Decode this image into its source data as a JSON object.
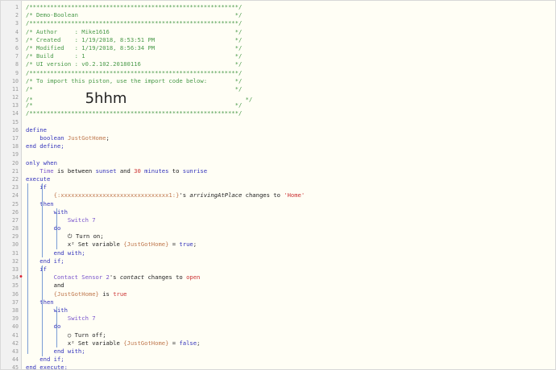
{
  "editor": {
    "lines": [
      {
        "n": "1",
        "parts": [
          {
            "t": "/************************************************************/",
            "c": "c"
          }
        ]
      },
      {
        "n": "2",
        "parts": [
          {
            "t": "/* Demo-Boolean                                             */",
            "c": "c"
          }
        ]
      },
      {
        "n": "3",
        "parts": [
          {
            "t": "/************************************************************/",
            "c": "c"
          }
        ]
      },
      {
        "n": "4",
        "parts": [
          {
            "t": "/* Author     : Mike1616                                    */",
            "c": "c"
          }
        ]
      },
      {
        "n": "5",
        "parts": [
          {
            "t": "/* Created    : 1/19/2018, 8:53:51 PM                       */",
            "c": "c"
          }
        ]
      },
      {
        "n": "6",
        "parts": [
          {
            "t": "/* Modified   : 1/19/2018, 8:56:34 PM                       */",
            "c": "c"
          }
        ]
      },
      {
        "n": "7",
        "parts": [
          {
            "t": "/* Build      : 1                                           */",
            "c": "c"
          }
        ]
      },
      {
        "n": "8",
        "parts": [
          {
            "t": "/* UI version : v0.2.102.20180116                           */",
            "c": "c"
          }
        ]
      },
      {
        "n": "9",
        "parts": [
          {
            "t": "/************************************************************/",
            "c": "c"
          }
        ]
      },
      {
        "n": "10",
        "parts": [
          {
            "t": "/* To import this piston, use the import code below:        */",
            "c": "c"
          }
        ]
      },
      {
        "n": "11",
        "parts": [
          {
            "t": "/*                                                          */",
            "c": "c"
          }
        ]
      },
      {
        "n": "12",
        "parts": [
          {
            "t": "/*               ",
            "c": "c"
          },
          {
            "t": "5hhm",
            "c": "big"
          },
          {
            "t": "                                  */",
            "c": "c"
          }
        ]
      },
      {
        "n": "13",
        "parts": [
          {
            "t": "/*                                                          */",
            "c": "c"
          }
        ]
      },
      {
        "n": "14",
        "parts": [
          {
            "t": "/************************************************************/",
            "c": "c"
          }
        ]
      },
      {
        "n": "15",
        "parts": []
      },
      {
        "n": "16",
        "parts": [
          {
            "t": "define",
            "c": "k"
          }
        ]
      },
      {
        "n": "17",
        "parts": [
          {
            "t": "    boolean ",
            "c": "k"
          },
          {
            "t": "JustGotHome",
            "c": "v"
          },
          {
            "t": ";",
            "c": "t"
          }
        ]
      },
      {
        "n": "18",
        "parts": [
          {
            "t": "end define;",
            "c": "k"
          }
        ]
      },
      {
        "n": "19",
        "parts": []
      },
      {
        "n": "20",
        "parts": [
          {
            "t": "only when",
            "c": "k"
          }
        ]
      },
      {
        "n": "21",
        "parts": [
          {
            "t": "    Time ",
            "c": "d"
          },
          {
            "t": "is between ",
            "c": "t"
          },
          {
            "t": "sunset",
            "c": "k"
          },
          {
            "t": " and ",
            "c": "t"
          },
          {
            "t": "30",
            "c": "r"
          },
          {
            "t": " minutes",
            "c": "k"
          },
          {
            "t": " to ",
            "c": "t"
          },
          {
            "t": "sunrise",
            "c": "k"
          }
        ]
      },
      {
        "n": "22",
        "parts": [
          {
            "t": "execute",
            "c": "k"
          }
        ]
      },
      {
        "n": "23",
        "parts": [
          {
            "t": "    if",
            "c": "k"
          }
        ]
      },
      {
        "n": "24",
        "parts": [
          {
            "t": "        {:xxxxxxxxxxxxxxxxxxxxxxxxxxxxxxx1:}",
            "c": "v"
          },
          {
            "t": "'s ",
            "c": "t"
          },
          {
            "t": "arrivingAtPlace",
            "c": "t it"
          },
          {
            "t": " changes to ",
            "c": "t"
          },
          {
            "t": "'Home'",
            "c": "r"
          }
        ]
      },
      {
        "n": "25",
        "parts": [
          {
            "t": "    then",
            "c": "k"
          }
        ]
      },
      {
        "n": "26",
        "parts": [
          {
            "t": "        with",
            "c": "k"
          }
        ]
      },
      {
        "n": "27",
        "parts": [
          {
            "t": "            Switch 7",
            "c": "d"
          }
        ]
      },
      {
        "n": "28",
        "parts": [
          {
            "t": "        do",
            "c": "k"
          }
        ]
      },
      {
        "n": "29",
        "parts": [
          {
            "t": "            ⏻ Turn on;",
            "c": "t"
          }
        ]
      },
      {
        "n": "30",
        "parts": [
          {
            "t": "            x² Set variable ",
            "c": "t"
          },
          {
            "t": "{JustGotHome}",
            "c": "v"
          },
          {
            "t": " = ",
            "c": "t"
          },
          {
            "t": "true",
            "c": "k"
          },
          {
            "t": ";",
            "c": "t"
          }
        ]
      },
      {
        "n": "31",
        "parts": [
          {
            "t": "        end with;",
            "c": "k"
          }
        ]
      },
      {
        "n": "32",
        "parts": [
          {
            "t": "    end if;",
            "c": "k"
          }
        ]
      },
      {
        "n": "33",
        "parts": [
          {
            "t": "    if",
            "c": "k"
          }
        ]
      },
      {
        "n": "34",
        "parts": [
          {
            "t": "        Contact Sensor 2",
            "c": "d"
          },
          {
            "t": "'s ",
            "c": "t"
          },
          {
            "t": "contact",
            "c": "t it"
          },
          {
            "t": " changes to ",
            "c": "t"
          },
          {
            "t": "open",
            "c": "r"
          }
        ]
      },
      {
        "n": "35",
        "parts": [
          {
            "t": "        and",
            "c": "t"
          }
        ]
      },
      {
        "n": "36",
        "parts": [
          {
            "t": "        {JustGotHome}",
            "c": "v"
          },
          {
            "t": " is ",
            "c": "t"
          },
          {
            "t": "true",
            "c": "r"
          }
        ]
      },
      {
        "n": "37",
        "parts": [
          {
            "t": "    then",
            "c": "k"
          }
        ]
      },
      {
        "n": "38",
        "parts": [
          {
            "t": "        with",
            "c": "k"
          }
        ]
      },
      {
        "n": "39",
        "parts": [
          {
            "t": "            Switch 7",
            "c": "d"
          }
        ]
      },
      {
        "n": "40",
        "parts": [
          {
            "t": "        do",
            "c": "k"
          }
        ]
      },
      {
        "n": "41",
        "parts": [
          {
            "t": "            ◯ Turn off;",
            "c": "t"
          }
        ]
      },
      {
        "n": "42",
        "parts": [
          {
            "t": "            x² Set variable ",
            "c": "t"
          },
          {
            "t": "{JustGotHome}",
            "c": "v"
          },
          {
            "t": " = ",
            "c": "t"
          },
          {
            "t": "false",
            "c": "k"
          },
          {
            "t": ";",
            "c": "t"
          }
        ]
      },
      {
        "n": "43",
        "parts": [
          {
            "t": "        end with;",
            "c": "k"
          }
        ]
      },
      {
        "n": "44",
        "parts": [
          {
            "t": "    end if;",
            "c": "k"
          }
        ]
      },
      {
        "n": "45",
        "parts": [
          {
            "t": "end execute;",
            "c": "k"
          }
        ]
      }
    ]
  },
  "colors": {
    "comment": "#4a9a4a",
    "keyword": "#3333bb",
    "variable": "#c07a50",
    "device": "#7a55cc",
    "literal": "#cc3333",
    "background": "#fffef5"
  }
}
